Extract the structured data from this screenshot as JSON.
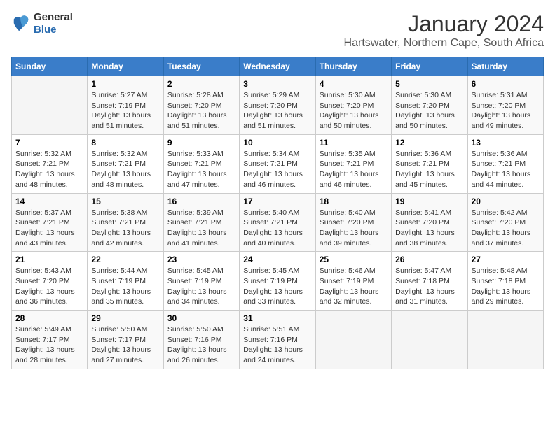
{
  "logo": {
    "general": "General",
    "blue": "Blue"
  },
  "title": "January 2024",
  "location": "Hartswater, Northern Cape, South Africa",
  "headers": [
    "Sunday",
    "Monday",
    "Tuesday",
    "Wednesday",
    "Thursday",
    "Friday",
    "Saturday"
  ],
  "weeks": [
    [
      {
        "day": "",
        "info": ""
      },
      {
        "day": "1",
        "info": "Sunrise: 5:27 AM\nSunset: 7:19 PM\nDaylight: 13 hours\nand 51 minutes."
      },
      {
        "day": "2",
        "info": "Sunrise: 5:28 AM\nSunset: 7:20 PM\nDaylight: 13 hours\nand 51 minutes."
      },
      {
        "day": "3",
        "info": "Sunrise: 5:29 AM\nSunset: 7:20 PM\nDaylight: 13 hours\nand 51 minutes."
      },
      {
        "day": "4",
        "info": "Sunrise: 5:30 AM\nSunset: 7:20 PM\nDaylight: 13 hours\nand 50 minutes."
      },
      {
        "day": "5",
        "info": "Sunrise: 5:30 AM\nSunset: 7:20 PM\nDaylight: 13 hours\nand 50 minutes."
      },
      {
        "day": "6",
        "info": "Sunrise: 5:31 AM\nSunset: 7:20 PM\nDaylight: 13 hours\nand 49 minutes."
      }
    ],
    [
      {
        "day": "7",
        "info": "Sunrise: 5:32 AM\nSunset: 7:21 PM\nDaylight: 13 hours\nand 48 minutes."
      },
      {
        "day": "8",
        "info": "Sunrise: 5:32 AM\nSunset: 7:21 PM\nDaylight: 13 hours\nand 48 minutes."
      },
      {
        "day": "9",
        "info": "Sunrise: 5:33 AM\nSunset: 7:21 PM\nDaylight: 13 hours\nand 47 minutes."
      },
      {
        "day": "10",
        "info": "Sunrise: 5:34 AM\nSunset: 7:21 PM\nDaylight: 13 hours\nand 46 minutes."
      },
      {
        "day": "11",
        "info": "Sunrise: 5:35 AM\nSunset: 7:21 PM\nDaylight: 13 hours\nand 46 minutes."
      },
      {
        "day": "12",
        "info": "Sunrise: 5:36 AM\nSunset: 7:21 PM\nDaylight: 13 hours\nand 45 minutes."
      },
      {
        "day": "13",
        "info": "Sunrise: 5:36 AM\nSunset: 7:21 PM\nDaylight: 13 hours\nand 44 minutes."
      }
    ],
    [
      {
        "day": "14",
        "info": "Sunrise: 5:37 AM\nSunset: 7:21 PM\nDaylight: 13 hours\nand 43 minutes."
      },
      {
        "day": "15",
        "info": "Sunrise: 5:38 AM\nSunset: 7:21 PM\nDaylight: 13 hours\nand 42 minutes."
      },
      {
        "day": "16",
        "info": "Sunrise: 5:39 AM\nSunset: 7:21 PM\nDaylight: 13 hours\nand 41 minutes."
      },
      {
        "day": "17",
        "info": "Sunrise: 5:40 AM\nSunset: 7:21 PM\nDaylight: 13 hours\nand 40 minutes."
      },
      {
        "day": "18",
        "info": "Sunrise: 5:40 AM\nSunset: 7:20 PM\nDaylight: 13 hours\nand 39 minutes."
      },
      {
        "day": "19",
        "info": "Sunrise: 5:41 AM\nSunset: 7:20 PM\nDaylight: 13 hours\nand 38 minutes."
      },
      {
        "day": "20",
        "info": "Sunrise: 5:42 AM\nSunset: 7:20 PM\nDaylight: 13 hours\nand 37 minutes."
      }
    ],
    [
      {
        "day": "21",
        "info": "Sunrise: 5:43 AM\nSunset: 7:20 PM\nDaylight: 13 hours\nand 36 minutes."
      },
      {
        "day": "22",
        "info": "Sunrise: 5:44 AM\nSunset: 7:19 PM\nDaylight: 13 hours\nand 35 minutes."
      },
      {
        "day": "23",
        "info": "Sunrise: 5:45 AM\nSunset: 7:19 PM\nDaylight: 13 hours\nand 34 minutes."
      },
      {
        "day": "24",
        "info": "Sunrise: 5:45 AM\nSunset: 7:19 PM\nDaylight: 13 hours\nand 33 minutes."
      },
      {
        "day": "25",
        "info": "Sunrise: 5:46 AM\nSunset: 7:19 PM\nDaylight: 13 hours\nand 32 minutes."
      },
      {
        "day": "26",
        "info": "Sunrise: 5:47 AM\nSunset: 7:18 PM\nDaylight: 13 hours\nand 31 minutes."
      },
      {
        "day": "27",
        "info": "Sunrise: 5:48 AM\nSunset: 7:18 PM\nDaylight: 13 hours\nand 29 minutes."
      }
    ],
    [
      {
        "day": "28",
        "info": "Sunrise: 5:49 AM\nSunset: 7:17 PM\nDaylight: 13 hours\nand 28 minutes."
      },
      {
        "day": "29",
        "info": "Sunrise: 5:50 AM\nSunset: 7:17 PM\nDaylight: 13 hours\nand 27 minutes."
      },
      {
        "day": "30",
        "info": "Sunrise: 5:50 AM\nSunset: 7:16 PM\nDaylight: 13 hours\nand 26 minutes."
      },
      {
        "day": "31",
        "info": "Sunrise: 5:51 AM\nSunset: 7:16 PM\nDaylight: 13 hours\nand 24 minutes."
      },
      {
        "day": "",
        "info": ""
      },
      {
        "day": "",
        "info": ""
      },
      {
        "day": "",
        "info": ""
      }
    ]
  ]
}
